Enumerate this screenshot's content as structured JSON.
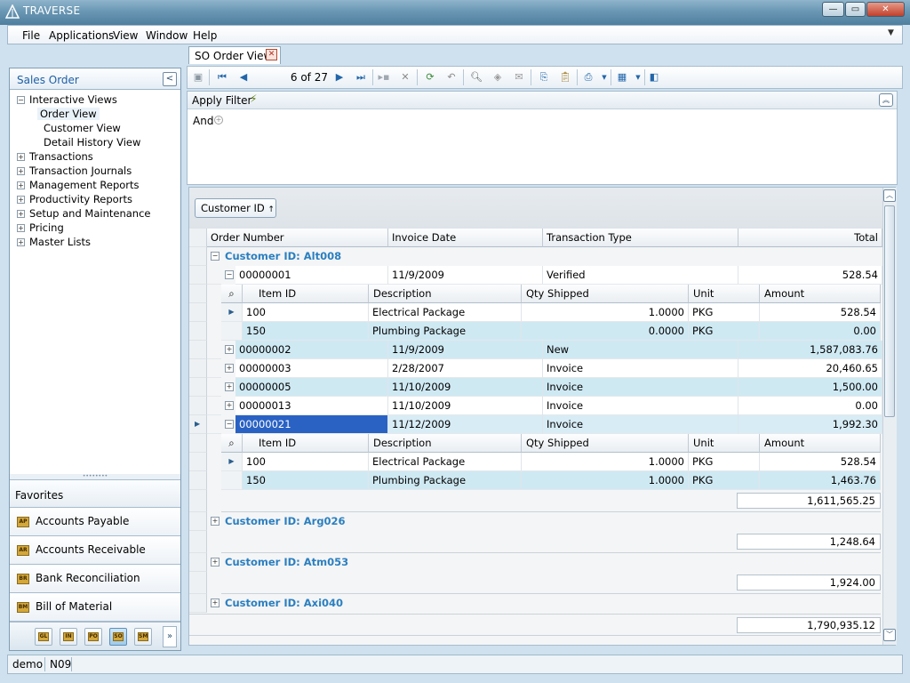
{
  "window": {
    "title": "TRAVERSE"
  },
  "menu": [
    "File",
    "Applications",
    "View",
    "Window",
    "Help"
  ],
  "left_panel": {
    "title": "Sales Order",
    "tree": [
      {
        "label": "Interactive Views",
        "expanded": true,
        "children": [
          "Order View",
          "Customer View",
          "Detail History View"
        ]
      },
      {
        "label": "Transactions"
      },
      {
        "label": "Transaction Journals"
      },
      {
        "label": "Management Reports"
      },
      {
        "label": "Productivity Reports"
      },
      {
        "label": "Setup and Maintenance"
      },
      {
        "label": "Pricing"
      },
      {
        "label": "Master Lists"
      }
    ],
    "favorites_label": "Favorites",
    "nav_buttons": [
      {
        "label": "Accounts Payable",
        "code": "AP"
      },
      {
        "label": "Accounts Receivable",
        "code": "AR"
      },
      {
        "label": "Bank Reconciliation",
        "code": "BR"
      },
      {
        "label": "Bill of Material",
        "code": "BM"
      }
    ],
    "module_buttons": [
      "GL",
      "IN",
      "PO",
      "SO",
      "SM"
    ]
  },
  "tab": {
    "label": "SO Order View"
  },
  "toolbar": {
    "record_position": "6 of 27"
  },
  "filter": {
    "apply_label": "Apply Filter",
    "and_label": "And"
  },
  "grid": {
    "group_chip": "Customer ID",
    "columns": [
      "Order Number",
      "Invoice Date",
      "Transaction Type",
      "Total"
    ],
    "detail_columns": [
      "Item ID",
      "Description",
      "Qty Shipped",
      "Unit",
      "Amount"
    ],
    "groups": [
      {
        "label": "Customer ID: Alt008",
        "total": "1,611,565.25",
        "orders": [
          {
            "number": "00000001",
            "date": "11/9/2009",
            "type": "Verified",
            "total": "528.54",
            "expanded": true,
            "items": [
              {
                "id": "100",
                "desc": "Electrical Package",
                "qty": "1.0000",
                "unit": "PKG",
                "amount": "528.54"
              },
              {
                "id": "150",
                "desc": "Plumbing Package",
                "qty": "0.0000",
                "unit": "PKG",
                "amount": "0.00"
              }
            ]
          },
          {
            "number": "00000002",
            "date": "11/9/2009",
            "type": "New",
            "total": "1,587,083.76"
          },
          {
            "number": "00000003",
            "date": "2/28/2007",
            "type": "Invoice",
            "total": "20,460.65"
          },
          {
            "number": "00000005",
            "date": "11/10/2009",
            "type": "Invoice",
            "total": "1,500.00"
          },
          {
            "number": "00000013",
            "date": "11/10/2009",
            "type": "Invoice",
            "total": "0.00"
          },
          {
            "number": "00000021",
            "date": "11/12/2009",
            "type": "Invoice",
            "total": "1,992.30",
            "expanded": true,
            "selected": true,
            "items": [
              {
                "id": "100",
                "desc": "Electrical Package",
                "qty": "1.0000",
                "unit": "PKG",
                "amount": "528.54"
              },
              {
                "id": "150",
                "desc": "Plumbing Package",
                "qty": "1.0000",
                "unit": "PKG",
                "amount": "1,463.76"
              }
            ]
          }
        ]
      },
      {
        "label": "Customer ID: Arg026",
        "total": "1,248.64"
      },
      {
        "label": "Customer ID: Atm053",
        "total": "1,924.00"
      },
      {
        "label": "Customer ID: Axi040"
      }
    ],
    "grand_total": "1,790,935.12"
  },
  "status": {
    "user": "demo",
    "company": "N09"
  },
  "colors": {
    "accent": "#2b7fc0",
    "row_alt": "#cfe9f3",
    "selected": "#2a62c4"
  }
}
